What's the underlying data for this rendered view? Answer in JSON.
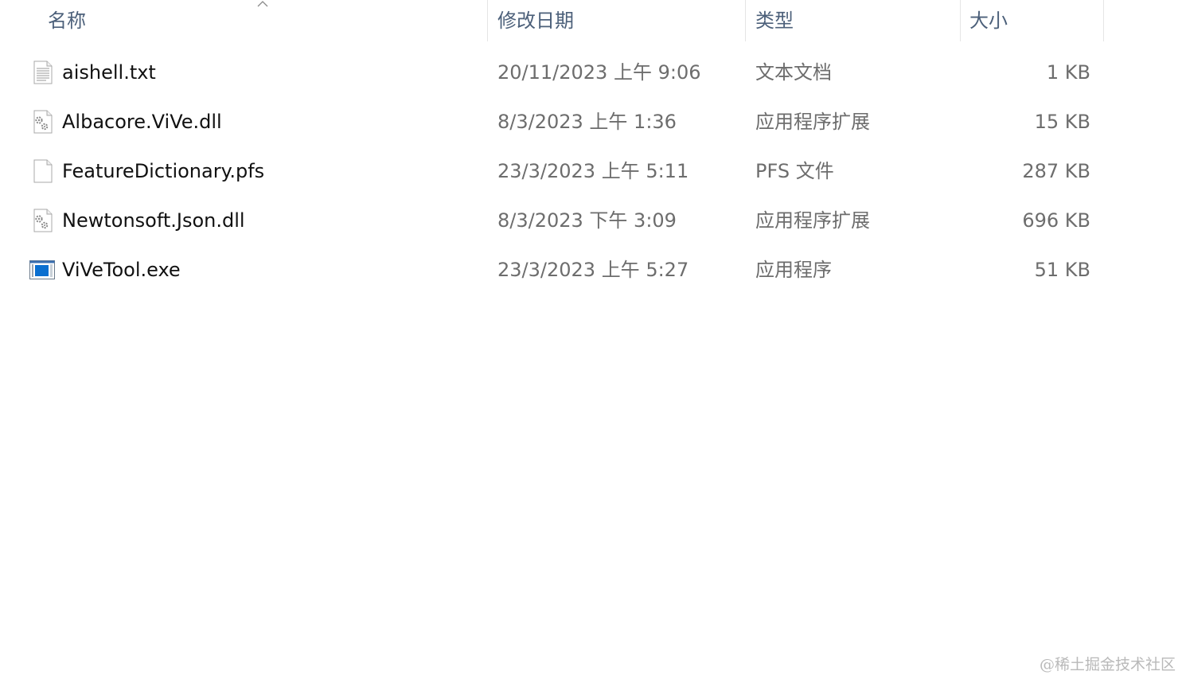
{
  "columns": {
    "name": "名称",
    "date": "修改日期",
    "type": "类型",
    "size": "大小"
  },
  "sort": {
    "column": "name",
    "direction": "ascending",
    "icon": "chevron-up-icon"
  },
  "files": [
    {
      "name": "aishell.txt",
      "date": "20/11/2023 上午 9:06",
      "type": "文本文档",
      "size": "1 KB",
      "icon": "text-file-icon"
    },
    {
      "name": "Albacore.ViVe.dll",
      "date": "8/3/2023 上午 1:36",
      "type": "应用程序扩展",
      "size": "15 KB",
      "icon": "dll-file-icon"
    },
    {
      "name": "FeatureDictionary.pfs",
      "date": "23/3/2023 上午 5:11",
      "type": "PFS 文件",
      "size": "287 KB",
      "icon": "blank-file-icon"
    },
    {
      "name": "Newtonsoft.Json.dll",
      "date": "8/3/2023 下午 3:09",
      "type": "应用程序扩展",
      "size": "696 KB",
      "icon": "dll-file-icon"
    },
    {
      "name": "ViVeTool.exe",
      "date": "23/3/2023 上午 5:27",
      "type": "应用程序",
      "size": "51 KB",
      "icon": "exe-file-icon"
    }
  ],
  "watermark": "@稀土掘金技术社区"
}
